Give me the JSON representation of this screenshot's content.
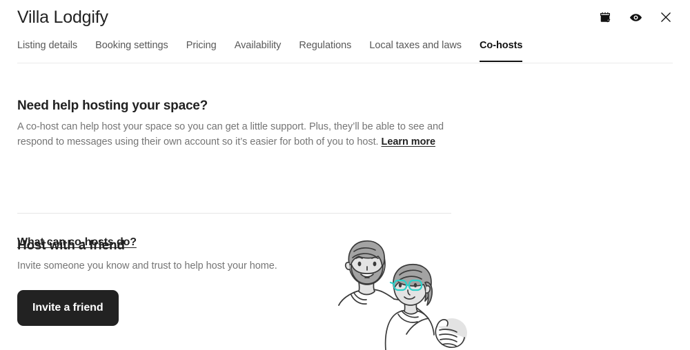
{
  "header": {
    "title": "Villa Lodgify",
    "actions": [
      {
        "name": "calendar-icon",
        "label": "Calendar"
      },
      {
        "name": "eye-icon",
        "label": "Preview"
      },
      {
        "name": "close-icon",
        "label": "Close"
      }
    ]
  },
  "tabs": [
    {
      "label": "Listing details",
      "active": false
    },
    {
      "label": "Booking settings",
      "active": false
    },
    {
      "label": "Pricing",
      "active": false
    },
    {
      "label": "Availability",
      "active": false
    },
    {
      "label": "Regulations",
      "active": false
    },
    {
      "label": "Local taxes and laws",
      "active": false
    },
    {
      "label": "Co-hosts",
      "active": true
    }
  ],
  "help_section": {
    "title": "Need help hosting your space?",
    "body_part1": "A co-host can help host your space so you can get a little support. Plus, they’ll be able to see and respond to messages using their own account so it’s easier for both of you to host. ",
    "learn_more": "Learn more",
    "cohost_link": "What can co-hosts do?"
  },
  "friend_section": {
    "title": "Host with a friend",
    "subtitle": "Invite someone you know and trust to help host your home.",
    "button_label": "Invite a friend",
    "illustration_name": "two-people-illustration"
  },
  "colors": {
    "text_primary": "#222222",
    "text_muted": "#757575",
    "button_bg": "#222222",
    "button_text": "#ffffff",
    "accent_teal": "#2ecfc8",
    "hair_gray": "#a3a3a3",
    "skin_gray": "#e3e3e3",
    "line_dark": "#3a3a3a",
    "divider": "#e6e6e6"
  }
}
